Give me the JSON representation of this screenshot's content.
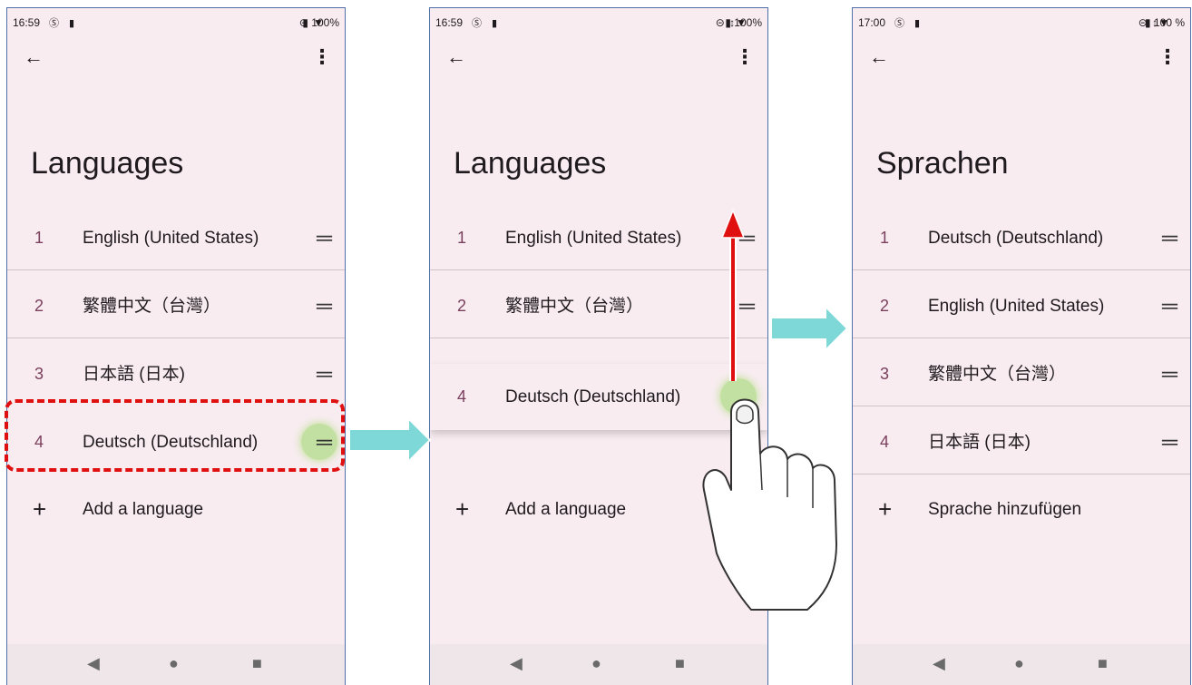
{
  "panel1": {
    "status": {
      "time": "16:59",
      "left_icons": "Ⓢ ▮",
      "right_icons": "⊝ ▼",
      "battery": "▮ 100%"
    },
    "title": "Languages",
    "languages": [
      {
        "num": "1",
        "label": "English (United States)"
      },
      {
        "num": "2",
        "label": "繁體中文（台灣）"
      },
      {
        "num": "3",
        "label": "日本語 (日本)"
      },
      {
        "num": "4",
        "label": "Deutsch (Deutschland)"
      }
    ],
    "add_label": "Add a language"
  },
  "panel2": {
    "status": {
      "time": "16:59",
      "left_icons": "Ⓢ ▮",
      "right_icons": "⊝ ↕▼",
      "battery": "▮ 100%"
    },
    "title": "Languages",
    "languages": [
      {
        "num": "1",
        "label": "English (United States)"
      },
      {
        "num": "2",
        "label": "繁體中文（台灣）"
      },
      {
        "num": "4",
        "label": "Deutsch (Deutschland)"
      }
    ],
    "add_label": "Add a language"
  },
  "panel3": {
    "status": {
      "time": "17:00",
      "left_icons": "Ⓢ ▮",
      "right_icons": "⊝ ↕▼",
      "battery": "▮ 100 %"
    },
    "title": "Sprachen",
    "languages": [
      {
        "num": "1",
        "label": "Deutsch (Deutschland)"
      },
      {
        "num": "2",
        "label": "English (United States)"
      },
      {
        "num": "3",
        "label": "繁體中文（台灣）"
      },
      {
        "num": "4",
        "label": "日本語 (日本)"
      }
    ],
    "add_label": "Sprache hinzufügen"
  },
  "icons": {
    "back": "←",
    "more": "⋮",
    "drag_handle": "═",
    "add": "+",
    "nav_back": "◀",
    "nav_home": "●",
    "nav_recents": "■"
  },
  "colors": {
    "background": "#f8ecf1",
    "frame": "#4f6fa8",
    "flow_arrow": "#7fd8d8",
    "drag_arrow": "#e01010",
    "highlight": "#e01010",
    "touch": "#96d75f"
  }
}
